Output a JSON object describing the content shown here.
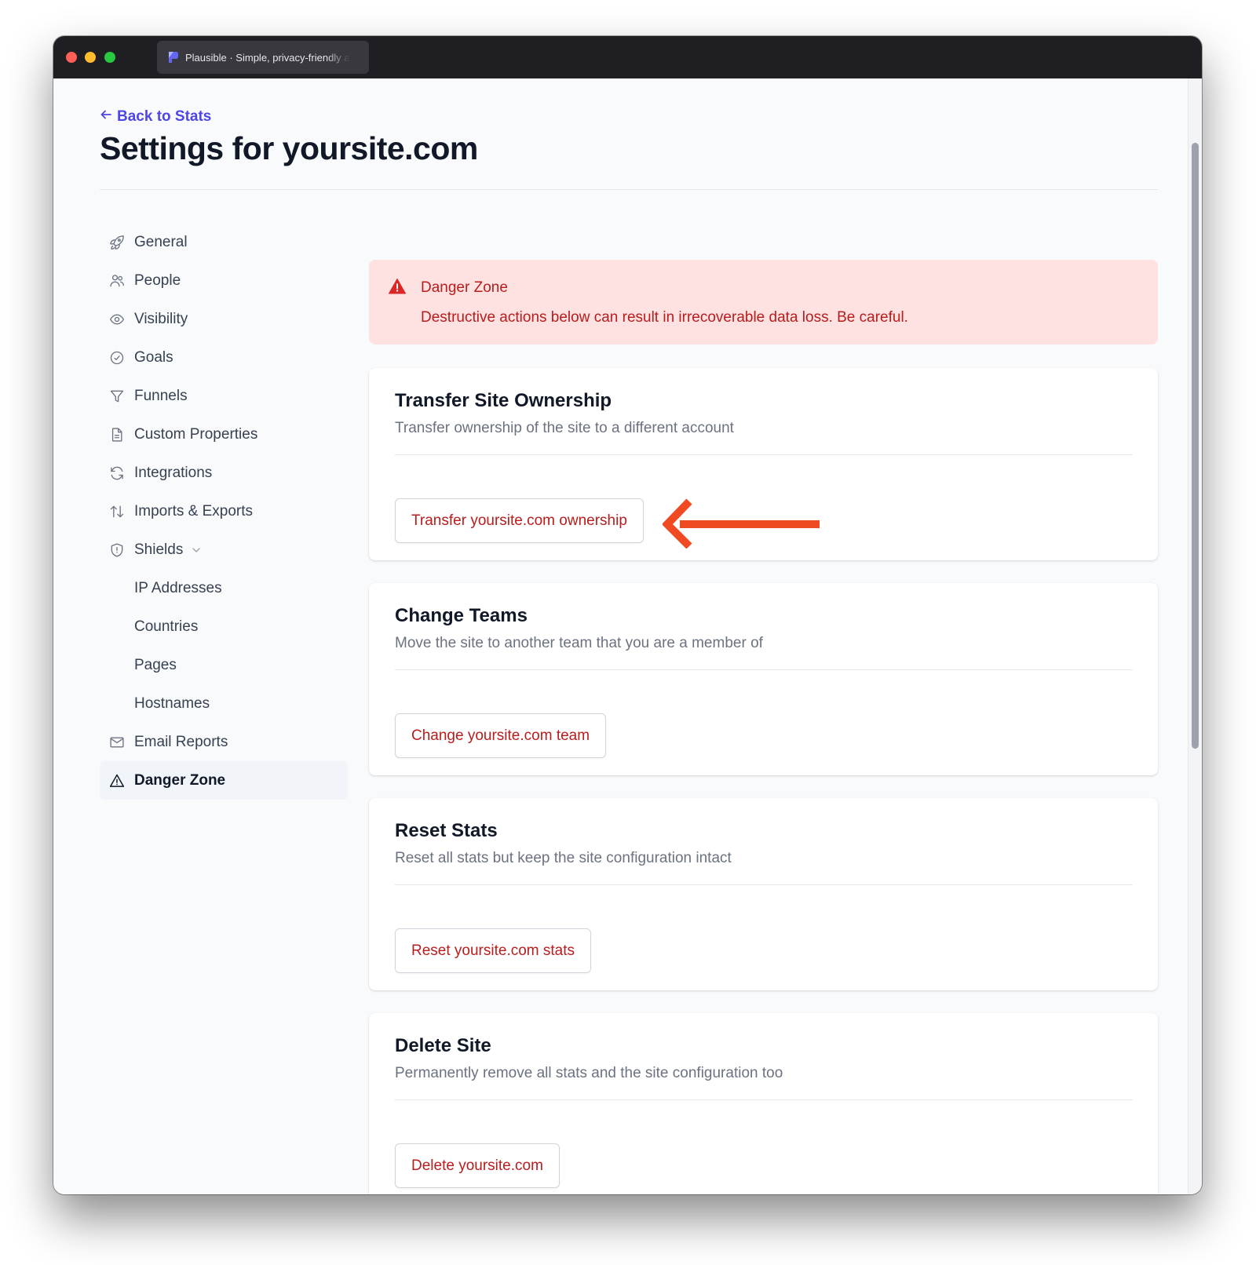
{
  "browser": {
    "tab_title": "Plausible · Simple, privacy-friendly analytics"
  },
  "header": {
    "back_link": "Back to Stats",
    "page_title": "Settings for yoursite.com"
  },
  "sidebar": {
    "items": [
      {
        "label": "General",
        "icon": "rocket-icon"
      },
      {
        "label": "People",
        "icon": "people-icon"
      },
      {
        "label": "Visibility",
        "icon": "eye-icon"
      },
      {
        "label": "Goals",
        "icon": "check-circle-icon"
      },
      {
        "label": "Funnels",
        "icon": "funnel-icon"
      },
      {
        "label": "Custom Properties",
        "icon": "document-icon"
      },
      {
        "label": "Integrations",
        "icon": "refresh-icon"
      },
      {
        "label": "Imports & Exports",
        "icon": "arrows-up-down-icon"
      },
      {
        "label": "Shields",
        "icon": "shield-icon"
      },
      {
        "label": "IP Addresses"
      },
      {
        "label": "Countries"
      },
      {
        "label": "Pages"
      },
      {
        "label": "Hostnames"
      },
      {
        "label": "Email Reports",
        "icon": "envelope-icon"
      },
      {
        "label": "Danger Zone",
        "icon": "warning-icon",
        "active": true
      }
    ]
  },
  "alert": {
    "title": "Danger Zone",
    "text": "Destructive actions below can result in irrecoverable data loss. Be careful.",
    "icon": "warning-icon"
  },
  "cards": [
    {
      "title": "Transfer Site Ownership",
      "description": "Transfer ownership of the site to a different account",
      "button": "Transfer yoursite.com ownership"
    },
    {
      "title": "Change Teams",
      "description": "Move the site to another team that you are a member of",
      "button": "Change yoursite.com team"
    },
    {
      "title": "Reset Stats",
      "description": "Reset all stats but keep the site configuration intact",
      "button": "Reset yoursite.com stats"
    },
    {
      "title": "Delete Site",
      "description": "Permanently remove all stats and the site configuration too",
      "button": "Delete yoursite.com"
    }
  ],
  "colors": {
    "accent": "#4f46e5",
    "danger": "#b91c1c",
    "alert_bg": "#fee2e2",
    "annotation_arrow": "#f04a23"
  }
}
